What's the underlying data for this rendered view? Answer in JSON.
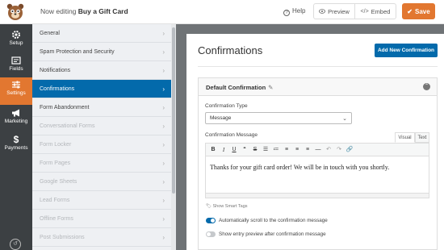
{
  "topbar": {
    "editing_prefix": "Now editing",
    "form_name": "Buy a Gift Card",
    "help_label": "Help",
    "preview_label": "Preview",
    "embed_label": "Embed",
    "save_label": "Save"
  },
  "leftbar": {
    "items": [
      {
        "label": "Setup",
        "icon": "gear-icon"
      },
      {
        "label": "Fields",
        "icon": "fields-icon"
      },
      {
        "label": "Settings",
        "icon": "sliders-icon"
      },
      {
        "label": "Marketing",
        "icon": "megaphone-icon"
      },
      {
        "label": "Payments",
        "icon": "dollar-icon"
      }
    ],
    "bottom_icon": "history-icon"
  },
  "settings": {
    "items": [
      {
        "label": "General",
        "state": "normal"
      },
      {
        "label": "Spam Protection and Security",
        "state": "normal"
      },
      {
        "label": "Notifications",
        "state": "normal"
      },
      {
        "label": "Confirmations",
        "state": "active"
      },
      {
        "label": "Form Abandonment",
        "state": "normal"
      },
      {
        "label": "Conversational Forms",
        "state": "disabled"
      },
      {
        "label": "Form Locker",
        "state": "disabled"
      },
      {
        "label": "Form Pages",
        "state": "disabled"
      },
      {
        "label": "Google Sheets",
        "state": "disabled"
      },
      {
        "label": "Lead Forms",
        "state": "disabled"
      },
      {
        "label": "Offline Forms",
        "state": "disabled"
      },
      {
        "label": "Post Submissions",
        "state": "disabled"
      }
    ]
  },
  "main": {
    "title": "Confirmations",
    "add_button": "Add New Confirmation",
    "confirmation": {
      "title": "Default Confirmation",
      "type_label": "Confirmation Type",
      "type_value": "Message",
      "message_label": "Confirmation Message",
      "tab_visual": "Visual",
      "tab_text": "Text",
      "message_text": "Thanks for your gift card order! We will be in touch with you shortly.",
      "smart_tags": "Show Smart Tags",
      "toggle_scroll_label": "Automatically scroll to the confirmation message",
      "toggle_scroll_on": true,
      "toggle_preview_label": "Show entry preview after confirmation message",
      "toggle_preview_on": false
    }
  },
  "colors": {
    "accent_orange": "#e27730",
    "accent_blue": "#036aab",
    "sidebar_dark": "#3c4043"
  }
}
